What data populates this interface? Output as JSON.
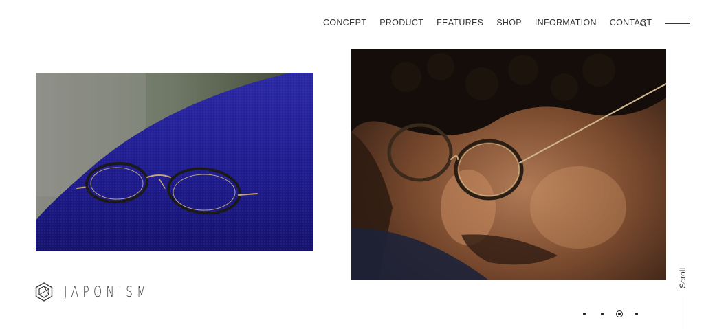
{
  "nav": {
    "items": [
      "CONCEPT",
      "PRODUCT",
      "FEATURES",
      "SHOP",
      "INFORMATION",
      "CONTACT"
    ]
  },
  "icons": {
    "search": "search-icon",
    "menu": "hamburger-menu-icon",
    "logo": "hexagon-logo-icon"
  },
  "brand": {
    "name": "JAPONISM"
  },
  "images": {
    "left": "eyeglasses on blue fabric",
    "right": "man wearing eyeglasses"
  },
  "slider": {
    "count": 4,
    "active_index": 2
  },
  "scroll": {
    "label": "Scroll"
  },
  "colors": {
    "background": "#ffffff",
    "text": "#333333",
    "fabric_blue": "#2a26a8"
  }
}
